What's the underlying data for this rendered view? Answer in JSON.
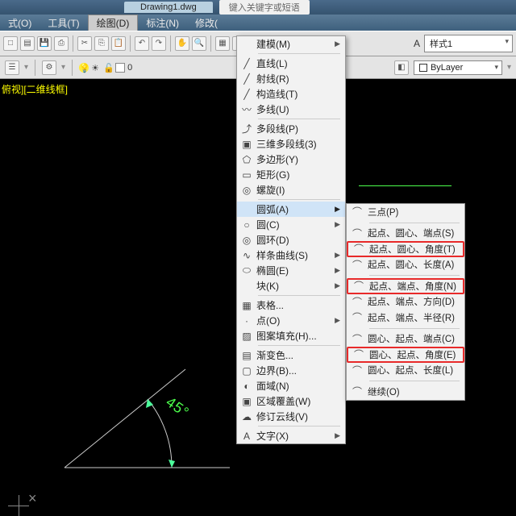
{
  "title": "Drawing1.dwg",
  "search_placeholder": "键入关键字或短语",
  "menubar": [
    "式(O)",
    "工具(T)",
    "绘图(D)",
    "标注(N)",
    "修改("
  ],
  "active_menu_index": 2,
  "style_dd": "样式1",
  "layer_dd": "ByLayer",
  "layer_value": "0",
  "viewport_label": "俯视][二维线框]",
  "angle_text": "45°",
  "draw_menu": [
    {
      "icon": "",
      "label": "建模(M)",
      "sub": true,
      "sep_after": true
    },
    {
      "icon": "╱",
      "label": "直线(L)"
    },
    {
      "icon": "╱",
      "label": "射线(R)"
    },
    {
      "icon": "╱",
      "label": "构造线(T)"
    },
    {
      "icon": "〰",
      "label": "多线(U)",
      "sep_after": true
    },
    {
      "icon": "⤴",
      "label": "多段线(P)"
    },
    {
      "icon": "▣",
      "label": "三维多段线(3)"
    },
    {
      "icon": "⬠",
      "label": "多边形(Y)"
    },
    {
      "icon": "▭",
      "label": "矩形(G)"
    },
    {
      "icon": "◎",
      "label": "螺旋(I)",
      "sep_after": true
    },
    {
      "icon": "",
      "label": "圆弧(A)",
      "sub": true,
      "hl": true
    },
    {
      "icon": "○",
      "label": "圆(C)",
      "sub": true
    },
    {
      "icon": "◎",
      "label": "圆环(D)"
    },
    {
      "icon": "∿",
      "label": "样条曲线(S)",
      "sub": true
    },
    {
      "icon": "⬭",
      "label": "椭圆(E)",
      "sub": true
    },
    {
      "icon": "",
      "label": "块(K)",
      "sub": true,
      "sep_after": true
    },
    {
      "icon": "▦",
      "label": "表格..."
    },
    {
      "icon": "·",
      "label": "点(O)",
      "sub": true
    },
    {
      "icon": "▨",
      "label": "图案填充(H)...",
      "sep_after": true
    },
    {
      "icon": "▤",
      "label": "渐变色..."
    },
    {
      "icon": "▢",
      "label": "边界(B)..."
    },
    {
      "icon": "◐",
      "label": "面域(N)"
    },
    {
      "icon": "▣",
      "label": "区域覆盖(W)"
    },
    {
      "icon": "☁",
      "label": "修订云线(V)",
      "sep_after": true
    },
    {
      "icon": "A",
      "label": "文字(X)",
      "sub": true
    }
  ],
  "arc_submenu": [
    {
      "icon": "⌒",
      "label": "三点(P)",
      "sep_after": true
    },
    {
      "icon": "⌒",
      "label": "起点、圆心、端点(S)"
    },
    {
      "icon": "⌒",
      "label": "起点、圆心、角度(T)",
      "red": true
    },
    {
      "icon": "⌒",
      "label": "起点、圆心、长度(A)",
      "sep_after": true
    },
    {
      "icon": "⌒",
      "label": "起点、端点、角度(N)",
      "red": true
    },
    {
      "icon": "⌒",
      "label": "起点、端点、方向(D)"
    },
    {
      "icon": "⌒",
      "label": "起点、端点、半径(R)",
      "sep_after": true
    },
    {
      "icon": "⌒",
      "label": "圆心、起点、端点(C)"
    },
    {
      "icon": "⌒",
      "label": "圆心、起点、角度(E)",
      "red": true
    },
    {
      "icon": "⌒",
      "label": "圆心、起点、长度(L)",
      "sep_after": true
    },
    {
      "icon": "⌒",
      "label": "继续(O)"
    }
  ]
}
